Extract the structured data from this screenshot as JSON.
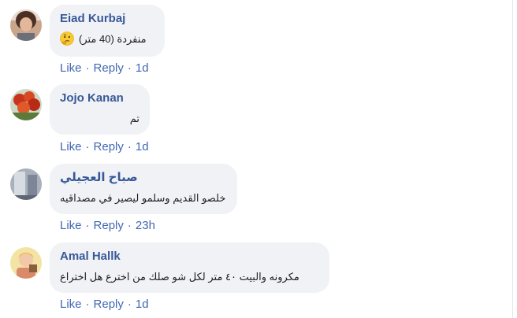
{
  "comments": [
    {
      "author": "Eiad Kurbaj",
      "text": "منفردة (40 متر)",
      "emoji": "thinking-face",
      "like_label": "Like",
      "reply_label": "Reply",
      "separator": "·",
      "time": "1d"
    },
    {
      "author": "Jojo Kanan",
      "text": "تم",
      "like_label": "Like",
      "reply_label": "Reply",
      "separator": "·",
      "time": "1d"
    },
    {
      "author": "صباح العجيلي",
      "text": "خلصو القديم وسلمو ليصير في مصداقيه",
      "like_label": "Like",
      "reply_label": "Reply",
      "separator": "·",
      "time": "23h"
    },
    {
      "author": "Amal Hallk",
      "text": "مكرونه والبيت ٤٠ متر لكل شو صلك من اخترع هل اختراع",
      "like_label": "Like",
      "reply_label": "Reply",
      "separator": "·",
      "time": "1d"
    }
  ],
  "colors": {
    "author": "#385898",
    "action_link": "#4267b2",
    "bubble_bg": "#f0f2f5",
    "text": "#1c1e21"
  }
}
